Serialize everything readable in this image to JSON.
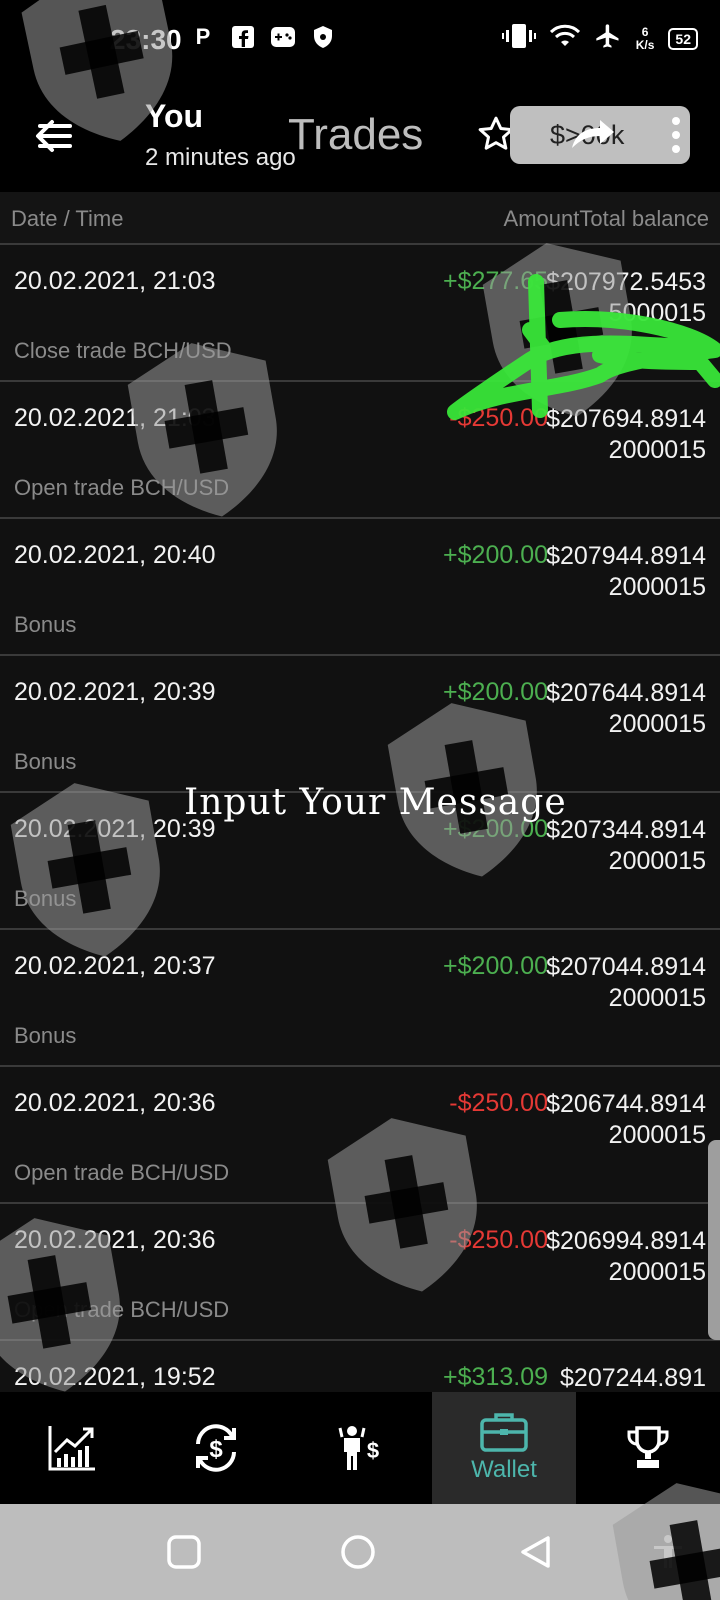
{
  "status_bar": {
    "time": "23:30",
    "left_icons": [
      "parking-icon",
      "facebook-icon",
      "game-controller-icon",
      "shield-dot-icon"
    ],
    "net_speed_value": "6",
    "net_speed_unit": "K/s",
    "battery": "52"
  },
  "header": {
    "user": "You",
    "time_ago": "2 minutes ago",
    "title": "Trades",
    "balance_pill": "$>00k"
  },
  "table": {
    "col_date": "Date  / Time",
    "col_amount": "Amount",
    "col_total": "Total balance",
    "rows": [
      {
        "date": "20.02.2021, 21:03",
        "amount": "+$277.65",
        "sign": "pos",
        "balance": "$207972.54535000015",
        "desc": "Close trade BCH/USD"
      },
      {
        "date": "20.02.2021, 21:03",
        "amount": "-$250.00",
        "sign": "neg",
        "balance": "$207694.89142000015",
        "desc": "Open trade BCH/USD"
      },
      {
        "date": "20.02.2021, 20:40",
        "amount": "+$200.00",
        "sign": "pos",
        "balance": "$207944.89142000015",
        "desc": "Bonus"
      },
      {
        "date": "20.02.2021, 20:39",
        "amount": "+$200.00",
        "sign": "pos",
        "balance": "$207644.89142000015",
        "desc": "Bonus"
      },
      {
        "date": "20.02.2021, 20:39",
        "amount": "+$200.00",
        "sign": "pos",
        "balance": "$207344.89142000015",
        "desc": "Bonus"
      },
      {
        "date": "20.02.2021, 20:37",
        "amount": "+$200.00",
        "sign": "pos",
        "balance": "$207044.89142000015",
        "desc": "Bonus"
      },
      {
        "date": "20.02.2021, 20:36",
        "amount": "-$250.00",
        "sign": "neg",
        "balance": "$206744.89142000015",
        "desc": "Open trade BCH/USD"
      },
      {
        "date": "20.02.2021, 20:36",
        "amount": "-$250.00",
        "sign": "neg",
        "balance": "$206994.89142000015",
        "desc": "Open trade BCH/USD"
      },
      {
        "date": "20.02.2021, 19:52",
        "amount": "+$313.09",
        "sign": "pos",
        "balance": "$207244.891",
        "desc": ""
      }
    ]
  },
  "bottom_nav": {
    "items": [
      {
        "icon": "chart-icon",
        "label": ""
      },
      {
        "icon": "exchange-dollar-icon",
        "label": ""
      },
      {
        "icon": "person-dollar-icon",
        "label": ""
      },
      {
        "icon": "wallet-icon",
        "label": "Wallet"
      },
      {
        "icon": "trophy-icon",
        "label": ""
      }
    ],
    "accent": "#4db6ac"
  },
  "overlay": {
    "message": "Input Your Message"
  },
  "colors": {
    "positive": "#4caf50",
    "negative": "#e53935",
    "scribble": "#39e639"
  }
}
